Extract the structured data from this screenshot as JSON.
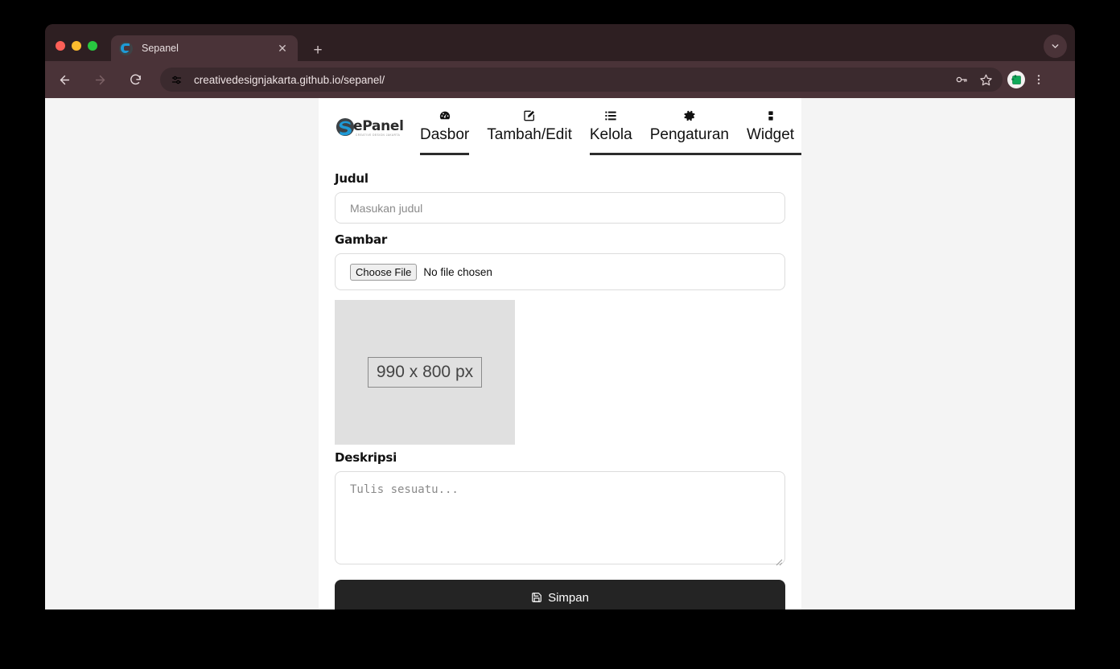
{
  "browser": {
    "tab": {
      "title": "Sepanel",
      "favicon": "sepanel-favicon",
      "close_icon": "close-icon"
    },
    "new_tab_icon": "plus-icon",
    "tabstrip_chevron_icon": "chevron-down-icon",
    "toolbar": {
      "back_icon": "back-arrow-icon",
      "forward_icon": "forward-arrow-icon",
      "reload_icon": "reload-icon",
      "site_info_icon": "tune-icon",
      "url": "creativedesignjakarta.github.io/sepanel/",
      "password_icon": "key-icon",
      "bookmark_icon": "star-icon",
      "extension_icon": "extension-puzzle-icon",
      "menu_icon": "three-dot-menu-icon"
    },
    "colors": {
      "tabstrip_bg": "#2e1f22",
      "toolbar_bg": "#4a3338",
      "active_tab_bg": "#4a3338",
      "omnibox_bg": "#3b2a2e",
      "traffic_red": "#ff5f57",
      "traffic_yellow": "#febc2e",
      "traffic_green": "#28c840"
    }
  },
  "page": {
    "brand": {
      "name": "ePanel",
      "tagline": "CREATIVE DESIGN JAKARTA",
      "mark": "s-logomark"
    },
    "nav": [
      {
        "label": "Dasbor",
        "icon": "gauge-icon",
        "active": true
      },
      {
        "label": "Tambah/Edit",
        "icon": "pen-to-square-icon",
        "active": false
      },
      {
        "label": "Kelola",
        "icon": "list-icon",
        "active": true
      },
      {
        "label": "Pengaturan",
        "icon": "gear-icon",
        "active": false
      },
      {
        "label": "Widget",
        "icon": "grip-vertical-icon",
        "active": false
      }
    ],
    "form": {
      "title_label": "Judul",
      "title_placeholder": "Masukan judul",
      "title_value": "",
      "image_label": "Gambar",
      "choose_file_button": "Choose File",
      "file_chosen_text": "No file chosen",
      "image_placeholder_alt": "990 x 800 px",
      "description_label": "Deskripsi",
      "description_placeholder": "Tulis sesuatu...",
      "description_value": "",
      "save_button": "Simpan",
      "save_icon": "floppy-disk-icon"
    },
    "colors": {
      "card_bg": "#ffffff",
      "viewport_bg": "#f4f4f4",
      "active_underline": "#2c2c2c",
      "save_button_bg": "#242424",
      "image_placeholder_bg": "#e0e0e0",
      "brand_blue": "#1e9ad6"
    }
  }
}
